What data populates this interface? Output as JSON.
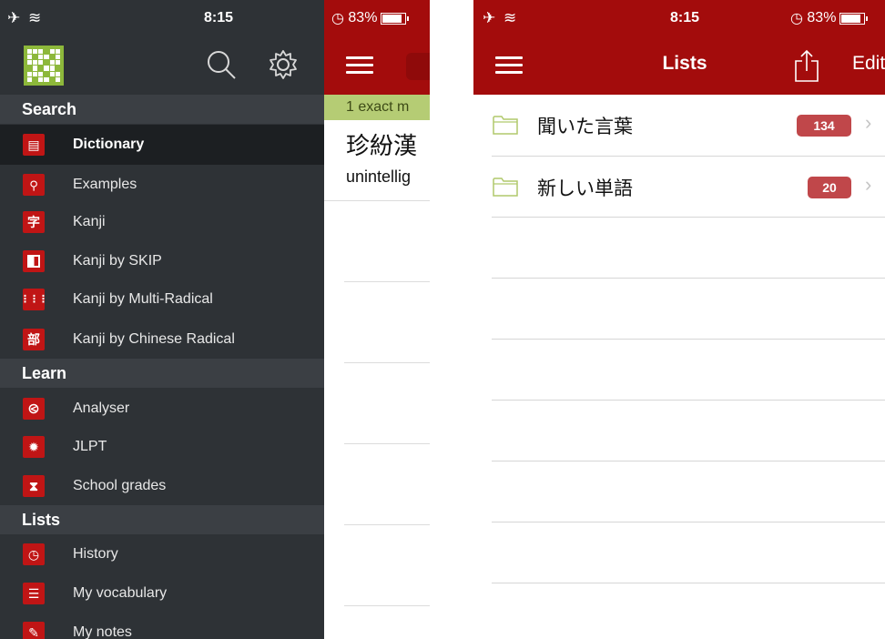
{
  "left_screen": {
    "status": {
      "left_icons": "✈ ︎≋",
      "time": "8:15",
      "battery_text": "83%"
    },
    "drawer": {
      "header_icons": [
        "qr-code-icon",
        "search-icon",
        "gear-icon"
      ],
      "sections": [
        {
          "title": "Search",
          "items": [
            {
              "label": "Dictionary",
              "icon": "▤",
              "icon_name": "dictionary-icon",
              "active": true
            },
            {
              "label": "Examples",
              "icon": "💬",
              "icon_name": "speech-bubbles-icon"
            },
            {
              "label": "Kanji",
              "icon": "字",
              "icon_name": "kanji-icon"
            },
            {
              "label": "Kanji by SKIP",
              "icon": "◧",
              "icon_name": "skip-icon"
            },
            {
              "label": "Kanji by Multi-Radical",
              "icon": "⁞⁞⁞",
              "icon_name": "multi-radical-icon"
            },
            {
              "label": "Kanji by Chinese Radical",
              "icon": "部",
              "icon_name": "chinese-radical-icon"
            }
          ]
        },
        {
          "title": "Learn",
          "items": [
            {
              "label": "Analyser",
              "icon": "⌇",
              "icon_name": "microscope-icon"
            },
            {
              "label": "JLPT",
              "icon": "✹",
              "icon_name": "badge-icon"
            },
            {
              "label": "School grades",
              "icon": "⧗",
              "icon_name": "hourglass-icon"
            }
          ]
        },
        {
          "title": "Lists",
          "items": [
            {
              "label": "History",
              "icon": "◷",
              "icon_name": "clock-icon"
            },
            {
              "label": "My vocabulary",
              "icon": "☰",
              "icon_name": "list-icon"
            },
            {
              "label": "My notes",
              "icon": "✎",
              "icon_name": "pencil-icon"
            }
          ]
        }
      ]
    },
    "peek": {
      "status_text": "83%",
      "match_text": "1 exact m",
      "result_kanji": "珍紛漢",
      "result_gloss": "unintellig"
    }
  },
  "right_screen": {
    "status": {
      "left_icons": "✈ ︎≋",
      "time": "8:15",
      "battery_text": "83%"
    },
    "nav": {
      "title": "Lists",
      "edit_label": "Edit"
    },
    "lists": [
      {
        "name": "聞いた言葉",
        "count": "134"
      },
      {
        "name": "新しい単語",
        "count": "20"
      }
    ],
    "empty_rows": 6
  },
  "colors": {
    "brand_red": "#a30c0c",
    "drawer_bg": "#2e3236",
    "badge": "#c0474a",
    "match_bar": "#b5cc74",
    "folder_green": "#b1c96c"
  }
}
